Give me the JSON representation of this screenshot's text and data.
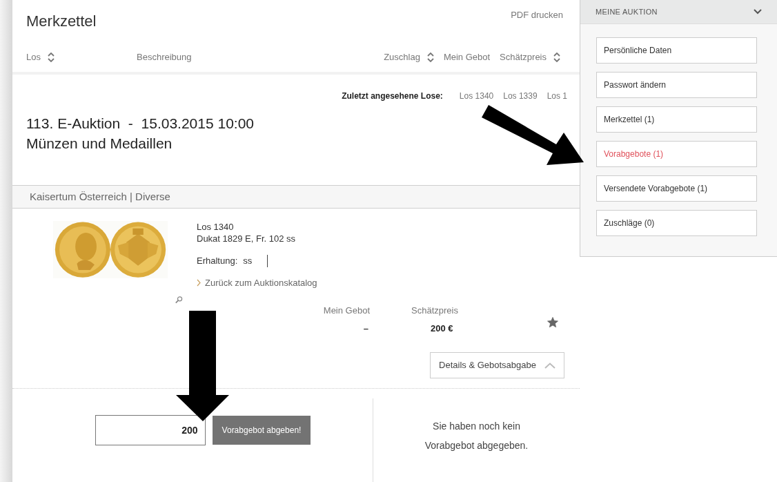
{
  "page_title": "Merkzettel",
  "pdf_link": "PDF drucken",
  "columns": [
    {
      "label": "Los",
      "sortable": true
    },
    {
      "label": "Beschreibung",
      "sortable": false
    },
    {
      "label": "Zuschlag",
      "sortable": true
    },
    {
      "label": "Mein Gebot",
      "sortable": false
    },
    {
      "label": "Schätzpreis",
      "sortable": true
    }
  ],
  "recently_viewed": {
    "label": "Zuletzt angesehene Lose:",
    "lots": [
      "Los 1340",
      "Los 1339",
      "Los 1"
    ]
  },
  "auction": {
    "title": "113. E-Auktion  -  15.03.2015 10:00",
    "subtitle": "Münzen und Medaillen"
  },
  "category": "Kaisertum Österreich | Diverse",
  "lot": {
    "number": "Los 1340",
    "description": "Dukat 1829 E, Fr. 102 ss",
    "condition_label": "Erhaltung:",
    "condition": "ss",
    "back_link": "Zurück zum Auktionskatalog",
    "my_bid_label": "Mein Gebot",
    "my_bid": "–",
    "estimate_label": "Schätzpreis",
    "estimate": "200 €",
    "favorite": true,
    "details_button": "Details & Gebotsabgabe",
    "expanded": true
  },
  "bid_form": {
    "value": "200",
    "button": "Vorabgebot abgeben!",
    "message": "Sie haben noch kein Vorabgebot abgegeben."
  },
  "sidebar": {
    "title": "MEINE AUKTION",
    "items": [
      {
        "label": "Persönliche Daten",
        "selected": false
      },
      {
        "label": "Passwort ändern",
        "selected": false
      },
      {
        "label": "Merkzettel (1)",
        "selected": false
      },
      {
        "label": "Vorabgebote (1)",
        "selected": true
      },
      {
        "label": "Versendete Vorabgebote (1)",
        "selected": false
      },
      {
        "label": "Zuschläge (0)",
        "selected": false
      }
    ]
  }
}
